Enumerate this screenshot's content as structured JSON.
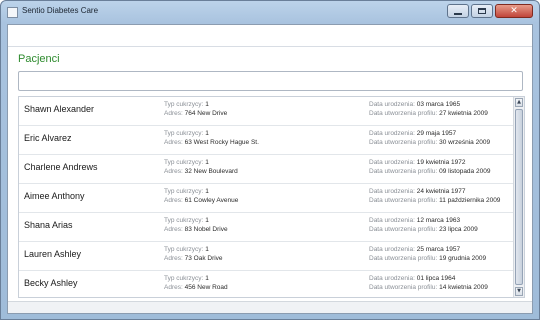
{
  "window": {
    "title": "Sentio Diabetes Care"
  },
  "main": {
    "section_title": "Pacjenci",
    "search": {
      "value": "",
      "placeholder": ""
    }
  },
  "labels": {
    "diabetes_type": "Typ cukrzycy:",
    "address": "Adres:",
    "birth_date": "Data urodzenia:",
    "profile_created": "Data utworzenia profilu:"
  },
  "patients": [
    {
      "name": "Shawn Alexander",
      "type": "1",
      "address": "764 New Drive",
      "birth": "03 marca 1965",
      "created": "27 kwietnia 2009"
    },
    {
      "name": "Eric Alvarez",
      "type": "1",
      "address": "63 West Rocky Hague St.",
      "birth": "29 maja 1957",
      "created": "30 września 2009"
    },
    {
      "name": "Charlene Andrews",
      "type": "1",
      "address": "32 New Boulevard",
      "birth": "19 kwietnia 1972",
      "created": "09 listopada 2009"
    },
    {
      "name": "Aimee Anthony",
      "type": "1",
      "address": "61 Cowley Avenue",
      "birth": "24 kwietnia 1977",
      "created": "11 października 2009"
    },
    {
      "name": "Shana Arias",
      "type": "1",
      "address": "83 Nobel Drive",
      "birth": "12 marca 1963",
      "created": "23 lipca 2009"
    },
    {
      "name": "Lauren Ashley",
      "type": "1",
      "address": "73 Oak Drive",
      "birth": "25 marca 1957",
      "created": "19 grudnia 2009"
    },
    {
      "name": "Becky Ashley",
      "type": "1",
      "address": "456 New Road",
      "birth": "01 lipca 1964",
      "created": "14 kwietnia 2009"
    }
  ],
  "icons": {
    "app": "app-icon",
    "minimize": "minimize-icon",
    "maximize": "maximize-icon",
    "close": "close-icon",
    "scroll_up": "scroll-up-arrow-icon",
    "scroll_down": "scroll-down-arrow-icon"
  },
  "colors": {
    "section_title": "#2e8b2e",
    "label": "#8a8f96",
    "titlebar": "#a9c3df",
    "close_button": "#c0453a"
  }
}
